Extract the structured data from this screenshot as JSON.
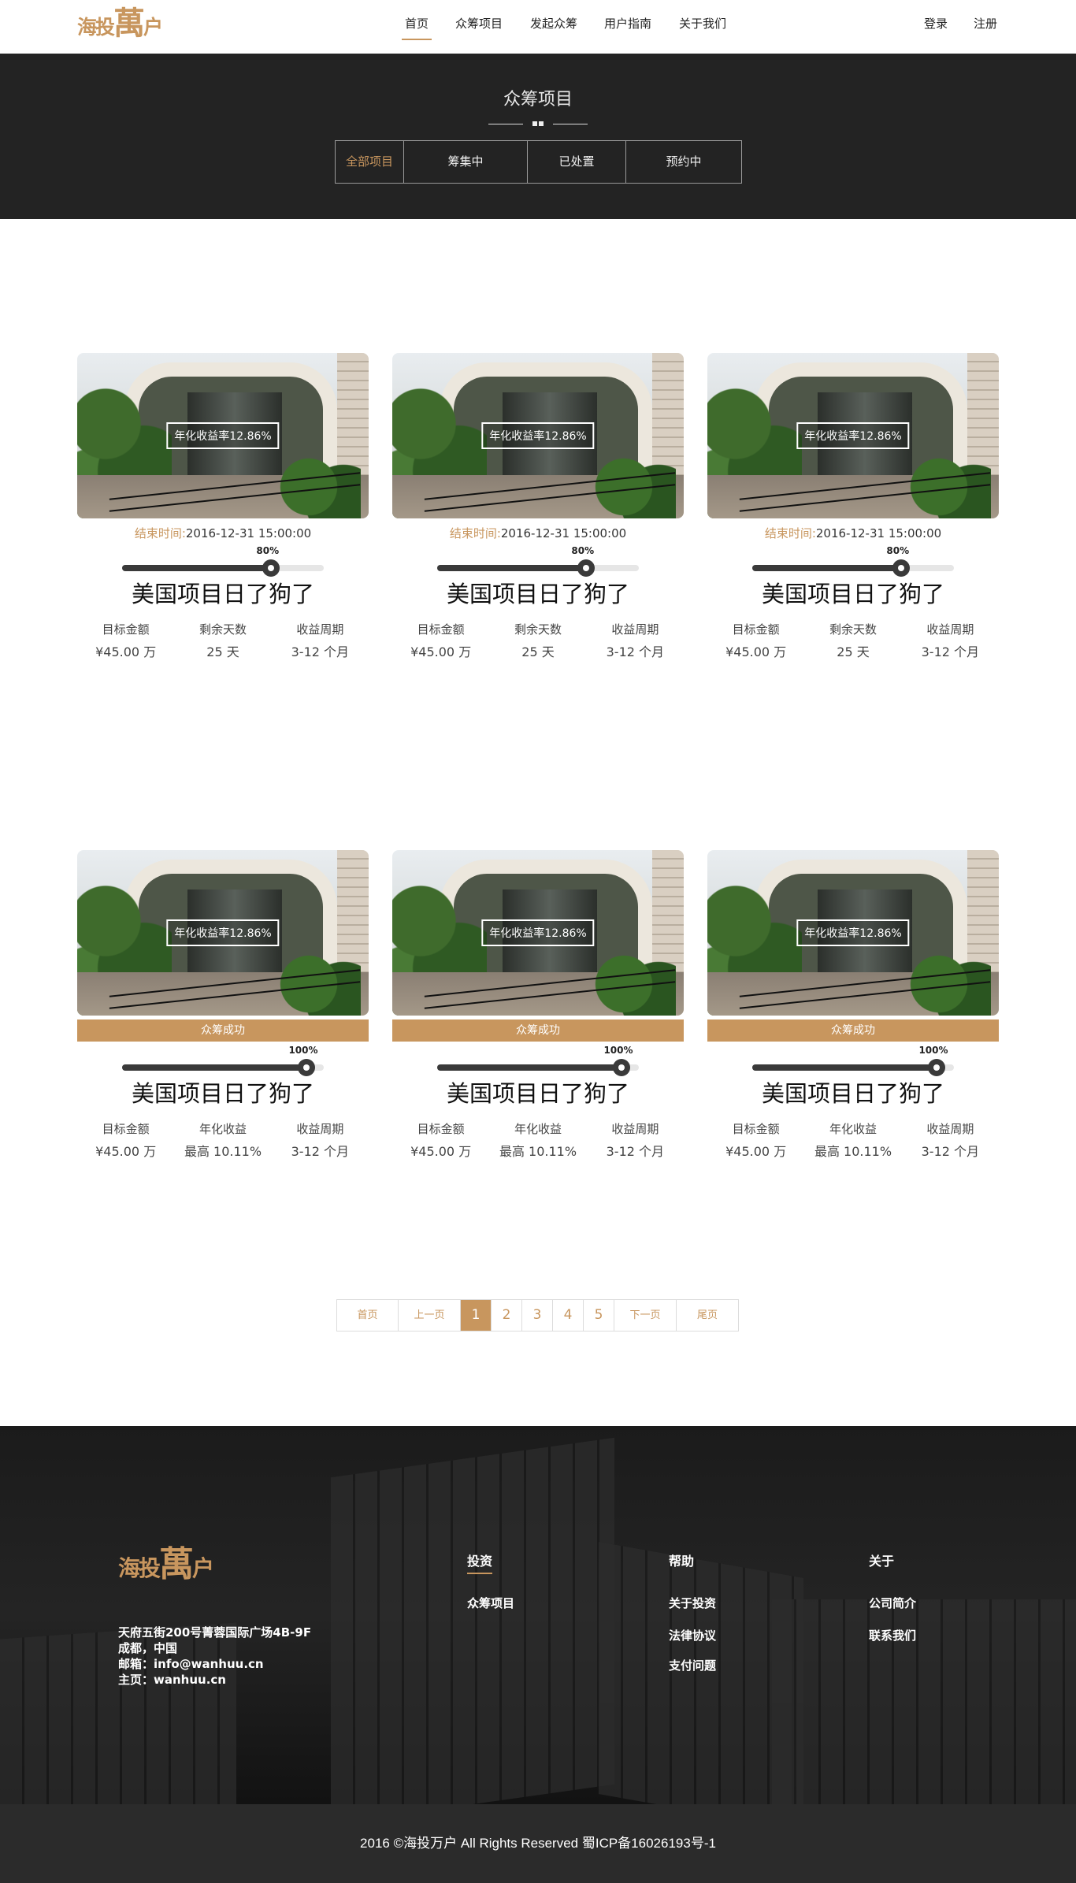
{
  "header": {
    "logo": {
      "big": "海投",
      "mid": "萬",
      "small": "户"
    },
    "nav": [
      {
        "label": "首页",
        "active": true
      },
      {
        "label": "众筹项目",
        "active": false
      },
      {
        "label": "发起众筹",
        "active": false
      },
      {
        "label": "用户指南",
        "active": false
      },
      {
        "label": "关于我们",
        "active": false
      }
    ],
    "login": "登录",
    "register": "注册"
  },
  "banner": {
    "title": "众筹项目",
    "filters": [
      {
        "label": "全部项目",
        "active": true
      },
      {
        "label": "筹集中",
        "active": false
      },
      {
        "label": "已处置",
        "active": false
      },
      {
        "label": "预约中",
        "active": false
      }
    ]
  },
  "cards_row1": [
    {
      "rate": "年化收益率12.86%",
      "end_label": "结束时间:",
      "end_value": "2016-12-31  15:00:00",
      "progress": 80,
      "progress_label": "80%",
      "title": "美国项目日了狗了",
      "stats": [
        {
          "k": "目标金额",
          "v": "¥45.00 万"
        },
        {
          "k": "剩余天数",
          "v": "25 天"
        },
        {
          "k": "收益周期",
          "v": "3-12 个月"
        }
      ]
    },
    {
      "rate": "年化收益率12.86%",
      "end_label": "结束时间:",
      "end_value": "2016-12-31  15:00:00",
      "progress": 80,
      "progress_label": "80%",
      "title": "美国项目日了狗了",
      "stats": [
        {
          "k": "目标金额",
          "v": "¥45.00 万"
        },
        {
          "k": "剩余天数",
          "v": "25 天"
        },
        {
          "k": "收益周期",
          "v": "3-12 个月"
        }
      ]
    },
    {
      "rate": "年化收益率12.86%",
      "end_label": "结束时间:",
      "end_value": "2016-12-31  15:00:00",
      "progress": 80,
      "progress_label": "80%",
      "title": "美国项目日了狗了",
      "stats": [
        {
          "k": "目标金额",
          "v": "¥45.00 万"
        },
        {
          "k": "剩余天数",
          "v": "25 天"
        },
        {
          "k": "收益周期",
          "v": "3-12 个月"
        }
      ]
    }
  ],
  "cards_row2": [
    {
      "rate": "年化收益率12.86%",
      "status": "众筹成功",
      "progress": 100,
      "progress_label": "100%",
      "title": "美国项目日了狗了",
      "stats": [
        {
          "k": "目标金额",
          "v": "¥45.00 万"
        },
        {
          "k": "年化收益",
          "v": "最高 10.11%"
        },
        {
          "k": "收益周期",
          "v": "3-12 个月"
        }
      ]
    },
    {
      "rate": "年化收益率12.86%",
      "status": "众筹成功",
      "progress": 100,
      "progress_label": "100%",
      "title": "美国项目日了狗了",
      "stats": [
        {
          "k": "目标金额",
          "v": "¥45.00 万"
        },
        {
          "k": "年化收益",
          "v": "最高 10.11%"
        },
        {
          "k": "收益周期",
          "v": "3-12 个月"
        }
      ]
    },
    {
      "rate": "年化收益率12.86%",
      "status": "众筹成功",
      "progress": 100,
      "progress_label": "100%",
      "title": "美国项目日了狗了",
      "stats": [
        {
          "k": "目标金额",
          "v": "¥45.00 万"
        },
        {
          "k": "年化收益",
          "v": "最高 10.11%"
        },
        {
          "k": "收益周期",
          "v": "3-12 个月"
        }
      ]
    }
  ],
  "pagination": {
    "first": "首页",
    "prev": "上一页",
    "pages": [
      "1",
      "2",
      "3",
      "4",
      "5"
    ],
    "current": "1",
    "next": "下一页",
    "last": "尾页"
  },
  "footer": {
    "address": [
      "天府五街200号菁蓉国际广场4B-9F",
      "成都，中国",
      "邮箱：info@wanhuu.cn",
      "主页：wanhuu.cn"
    ],
    "columns": [
      {
        "title": "投资",
        "links": [
          "众筹项目"
        ]
      },
      {
        "title": "帮助",
        "links": [
          "关于投资",
          "法律协议",
          "支付问题"
        ]
      },
      {
        "title": "关于",
        "links": [
          "公司简介",
          "联系我们"
        ]
      }
    ],
    "copyright": "2016 ©海投万户 All Rights Reserved  蜀ICP备16026193号-1"
  },
  "colors": {
    "accent": "#c8965e",
    "dark": "#232323"
  }
}
